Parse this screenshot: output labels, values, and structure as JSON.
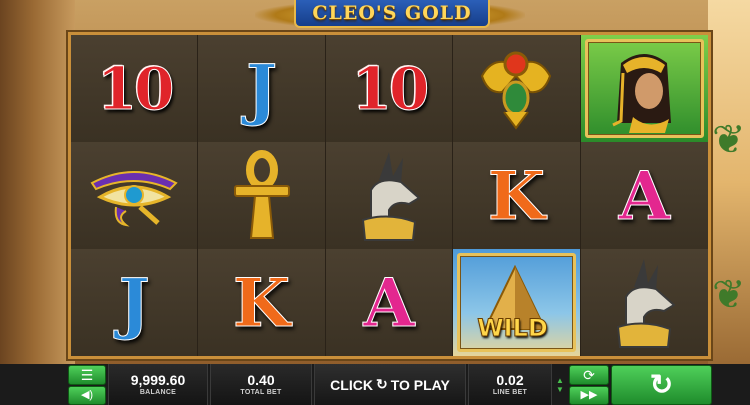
{
  "game": {
    "title": "CLEO'S GOLD"
  },
  "reels": [
    [
      {
        "symbol": "10",
        "kind": "number"
      },
      {
        "symbol": "J",
        "kind": "letter-J"
      },
      {
        "symbol": "10",
        "kind": "number"
      },
      {
        "symbol": "scarab",
        "kind": "icon"
      },
      {
        "symbol": "cleopatra",
        "kind": "icon"
      }
    ],
    [
      {
        "symbol": "eye-of-horus",
        "kind": "icon"
      },
      {
        "symbol": "ankh",
        "kind": "icon"
      },
      {
        "symbol": "anubis",
        "kind": "icon"
      },
      {
        "symbol": "K",
        "kind": "letter-K"
      },
      {
        "symbol": "A",
        "kind": "letter-A"
      }
    ],
    [
      {
        "symbol": "J",
        "kind": "letter-J"
      },
      {
        "symbol": "K",
        "kind": "letter-K"
      },
      {
        "symbol": "A",
        "kind": "letter-A"
      },
      {
        "symbol": "WILD",
        "kind": "wild"
      },
      {
        "symbol": "anubis",
        "kind": "icon"
      }
    ]
  ],
  "controls": {
    "balance_value": "9,999.60",
    "balance_label": "BALANCE",
    "total_bet_value": "0.40",
    "total_bet_label": "TOTAL BET",
    "click_label": "CLICK",
    "play_label": "TO PLAY",
    "line_bet_value": "0.02",
    "line_bet_label": "LINE BET"
  },
  "colors": {
    "accent_green": "#2fae3a",
    "frame_gold": "#c98f3a",
    "symbol_red": "#e0242a",
    "symbol_blue": "#2b8ad8",
    "symbol_orange": "#f06a1a",
    "symbol_pink": "#e3278f"
  },
  "icons": [
    "menu-icon",
    "sound-icon",
    "refresh-icon",
    "fast-forward-icon",
    "spin-icon",
    "bet-arrow-up-icon",
    "bet-arrow-down-icon"
  ]
}
